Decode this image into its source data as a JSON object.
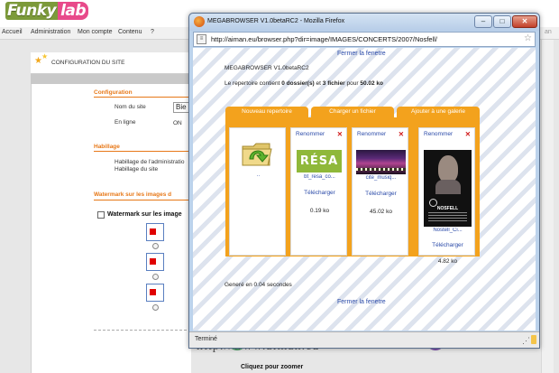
{
  "site": {
    "logo_part1": "Funky",
    "logo_part2": "lab",
    "nav": [
      "Accueil",
      "Administration",
      "Mon compte",
      "Contenu",
      "?"
    ],
    "nav_right": "an",
    "panel_title": "CONFIGURATION DU SITE",
    "sections": {
      "configuration": "Configuration",
      "habillage": "Habillage",
      "watermark": "Watermark sur les images d"
    },
    "fields": {
      "nom_du_site": "Nom du site",
      "nom_value": "Bie",
      "en_ligne": "En ligne",
      "en_ligne_value": "ON",
      "habillage_admin": "Habillage de l'administratio",
      "habillage_site": "Habillage du site"
    },
    "watermark_label": "Watermark sur les image",
    "preview_text": "http://www.aiman.eu",
    "zoom_label": "Cliquez pour zoomer"
  },
  "browser": {
    "title": "MEGABROWSER V1.0betaRC2 - Mozilla Firefox",
    "buttons": {
      "minimize": "–",
      "maximize": "□",
      "close": "✕"
    },
    "url": "http://aiman.eu/browser.php?dir=image/IMAGES/CONCERTS/2007/Nosfell/",
    "status": "Terminé",
    "page": {
      "close_link_top": "Fermer la fenetre",
      "app_name": "MEGABROWSER V1.0betaRC2",
      "summary_prefix": "Le repertoire contient ",
      "summary_folders": "0 dossier(s)",
      "summary_mid": " et ",
      "summary_files": "3 fichier",
      "summary_pour": " pour ",
      "summary_size": "50.02 ko",
      "tabs": [
        "Nouveau repertoire",
        "Charger un fichier",
        "Ajouter à une galerie"
      ],
      "parent_label": "..",
      "items": [
        {
          "rename": "Renommer",
          "delete": "✕",
          "name": "bt_resa_co...",
          "download": "Télécharger",
          "size": "0.19 ko",
          "thumb_text": "RÉSA"
        },
        {
          "rename": "Renommer",
          "delete": "✕",
          "name": "cite_musiq...",
          "download": "Télécharger",
          "size": "45.02 ko"
        },
        {
          "rename": "Renommer",
          "delete": "✕",
          "name": "Nostell_Ci...",
          "download": "Télécharger",
          "size": "4.82 ko",
          "poster_text": "NOSFELL"
        }
      ],
      "generated": "Generé en 0.04 secondes",
      "close_link_bottom": "Fermer la fenetre"
    }
  },
  "colors": {
    "tab_orange": "#f3a21d",
    "section_orange": "#e77818",
    "link_blue": "#2a4aa8",
    "delete_red": "#d01818"
  }
}
